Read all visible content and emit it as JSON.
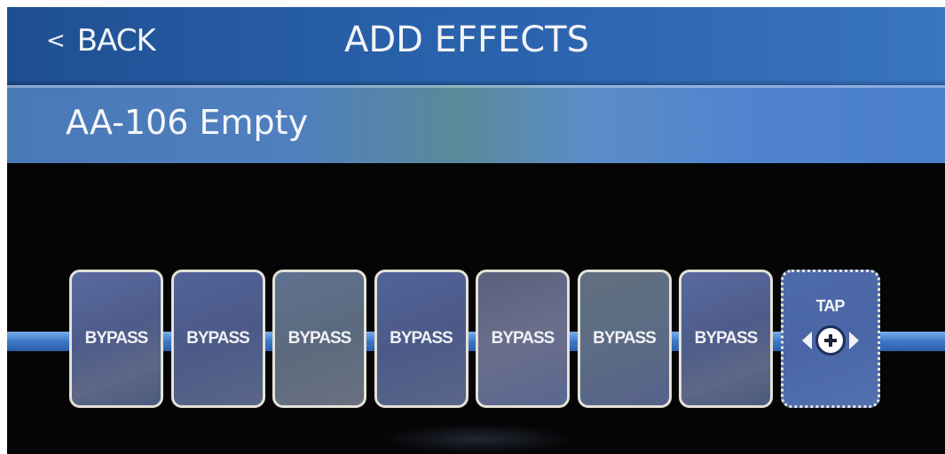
{
  "header": {
    "back_chevron": "<",
    "back_label": "BACK",
    "title": "ADD EFFECTS"
  },
  "preset": {
    "name": "AA-106 Empty"
  },
  "chain": {
    "slots": [
      {
        "label": "BYPASS"
      },
      {
        "label": "BYPASS"
      },
      {
        "label": "BYPASS"
      },
      {
        "label": "BYPASS"
      },
      {
        "label": "BYPASS"
      },
      {
        "label": "BYPASS"
      },
      {
        "label": "BYPASS"
      }
    ],
    "add_slot": {
      "label": "TAP",
      "icons": [
        "arrow-left-icon",
        "plus-circle-icon",
        "arrow-right-icon"
      ]
    }
  },
  "colors": {
    "header_blue": "#275ea6",
    "chain_line_blue": "#3d78c8",
    "background": "#050505",
    "slot_border": "#e4e1d6"
  }
}
